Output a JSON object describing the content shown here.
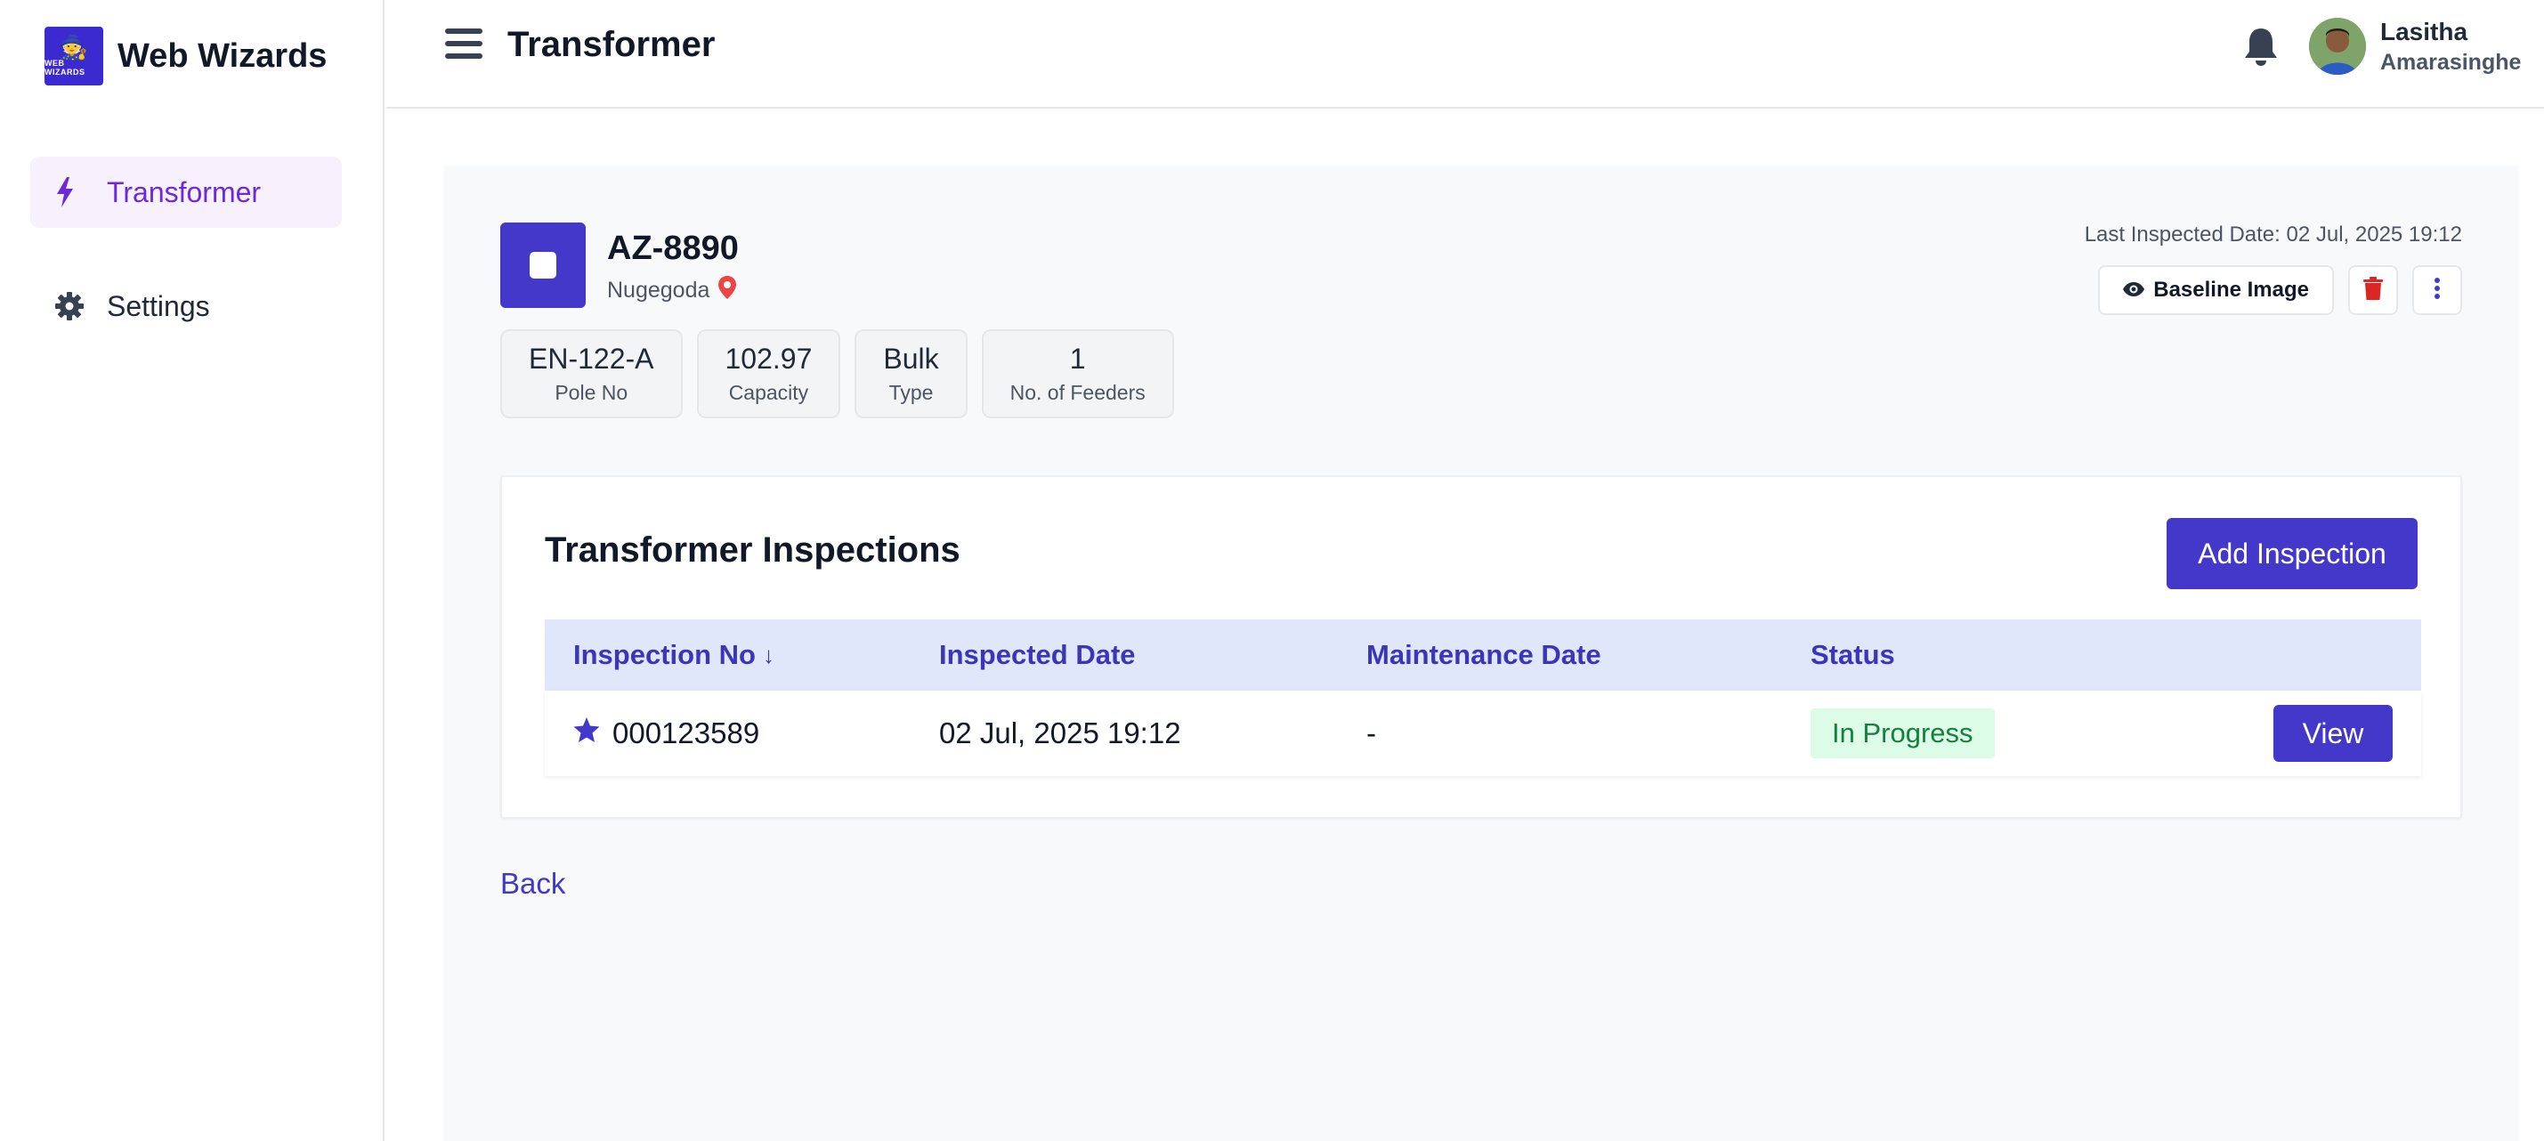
{
  "app": {
    "brand_name": "Web Wizards",
    "logo_tiny_text": "WEB WIZARDS"
  },
  "sidebar": {
    "items": [
      {
        "label": "Transformer",
        "icon": "bolt-icon",
        "active": true
      },
      {
        "label": "Settings",
        "icon": "gear-icon",
        "active": false
      }
    ]
  },
  "header": {
    "title": "Transformer",
    "user": {
      "first_name": "Lasitha",
      "last_name": "Amarasinghe"
    }
  },
  "transformer": {
    "id": "AZ-8890",
    "location": "Nugegoda",
    "last_inspected": "Last Inspected Date: 02 Jul, 2025 19:12",
    "stats": [
      {
        "value": "EN-122-A",
        "label": "Pole No"
      },
      {
        "value": "102.97",
        "label": "Capacity"
      },
      {
        "value": "Bulk",
        "label": "Type"
      },
      {
        "value": "1",
        "label": "No. of Feeders"
      }
    ],
    "baseline_label": "Baseline Image"
  },
  "inspections": {
    "title": "Transformer Inspections",
    "add_label": "Add Inspection",
    "columns": [
      "Inspection No",
      "Inspected Date",
      "Maintenance Date",
      "Status"
    ],
    "sort_indicator": "↓",
    "rows": [
      {
        "number": "000123589",
        "inspected_date": "02 Jul, 2025 19:12",
        "maintenance_date": "-",
        "status": "In Progress",
        "action_label": "View"
      }
    ]
  },
  "back_label": "Back",
  "colors": {
    "primary": "#4338ca",
    "active_nav_bg": "#f6f1fd",
    "active_nav_text": "#6d28d9",
    "status_bg": "#dcfce7",
    "status_text": "#15803d",
    "delete": "#dc2626",
    "table_header_bg": "#e0e7fb"
  }
}
